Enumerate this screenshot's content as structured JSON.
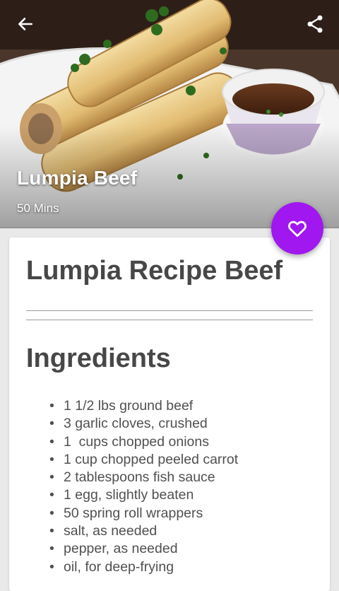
{
  "header": {
    "title": "Lumpia Beef",
    "duration": "50 Mins",
    "back_icon": "arrow-left",
    "share_icon": "share"
  },
  "fab": {
    "icon": "heart-outline",
    "color": "#a017f0"
  },
  "recipe": {
    "title": "Lumpia Recipe Beef",
    "ingredients_heading": "Ingredients",
    "ingredients": [
      "1 1/2 lbs ground beef",
      "3 garlic cloves, crushed",
      "1  cups chopped onions",
      "1 cup chopped peeled carrot",
      "2 tablespoons fish sauce",
      "1 egg, slightly beaten",
      "50 spring roll wrappers",
      "salt, as needed",
      "pepper, as needed",
      "oil, for deep-frying"
    ]
  }
}
